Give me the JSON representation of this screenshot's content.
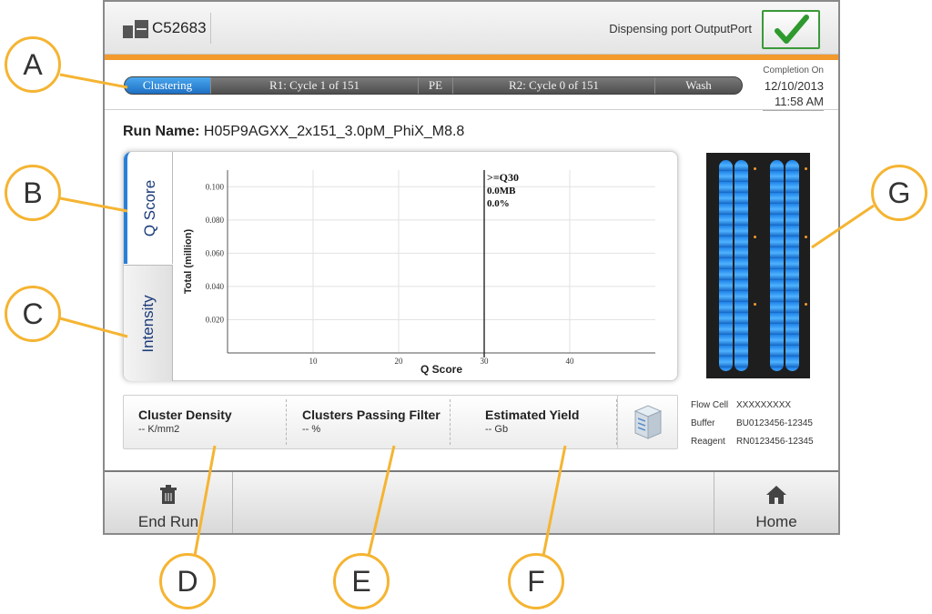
{
  "header": {
    "instrument_name": "C52683",
    "dispensing_port": "Dispensing port OutputPort"
  },
  "progress": {
    "segments": [
      {
        "label": "Clustering",
        "active": true
      },
      {
        "label": "R1: Cycle 1 of 151",
        "active": false
      },
      {
        "label": "PE",
        "active": false
      },
      {
        "label": "R2: Cycle 0 of 151",
        "active": false
      },
      {
        "label": "Wash",
        "active": false
      }
    ],
    "completion_label": "Completion On",
    "completion_date": "12/10/2013",
    "completion_time": "11:58 AM"
  },
  "run": {
    "label": "Run Name:",
    "value": "H05P9AGXX_2x151_3.0pM_PhiX_M8.8"
  },
  "tabs": {
    "qscore": "Q Score",
    "intensity": "Intensity"
  },
  "chart_data": {
    "type": "bar",
    "xlabel": "Q Score",
    "ylabel": "Total (million)",
    "xlim": [
      0,
      50
    ],
    "ylim": [
      0,
      0.11
    ],
    "xticks": [
      10,
      20,
      30,
      40
    ],
    "yticks": [
      0.02,
      0.04,
      0.06,
      0.08,
      0.1
    ],
    "ytick_labels": [
      "0.020",
      "0.040",
      "0.060",
      "0.080",
      "0.100"
    ],
    "grid": true,
    "threshold_x": 30,
    "annotation": [
      ">=Q30",
      "0.0MB",
      "0.0%"
    ],
    "values": []
  },
  "metrics": [
    {
      "title": "Cluster Density",
      "value": "-- K/mm2"
    },
    {
      "title": "Clusters Passing Filter",
      "value": "-- %"
    },
    {
      "title": "Estimated Yield",
      "value": "-- Gb"
    }
  ],
  "flowcell_info": {
    "flow_cell_label": "Flow Cell",
    "flow_cell_value": "XXXXXXXXX",
    "buffer_label": "Buffer",
    "buffer_value": "BU0123456-12345",
    "reagent_label": "Reagent",
    "reagent_value": "RN0123456-12345"
  },
  "footer": {
    "end_run": "End Run",
    "home": "Home"
  },
  "callouts": [
    "A",
    "B",
    "C",
    "D",
    "E",
    "F",
    "G"
  ],
  "colors": {
    "accent_orange": "#f39a2d",
    "active_blue": "#2a7fd8",
    "callout_border": "#f5b432",
    "check_green": "#2e9a2e",
    "lane_blue": "#1e82e8"
  },
  "icons": [
    "instrument-icon",
    "checkmark-icon",
    "reagent-icon",
    "trash-icon",
    "home-icon"
  ]
}
